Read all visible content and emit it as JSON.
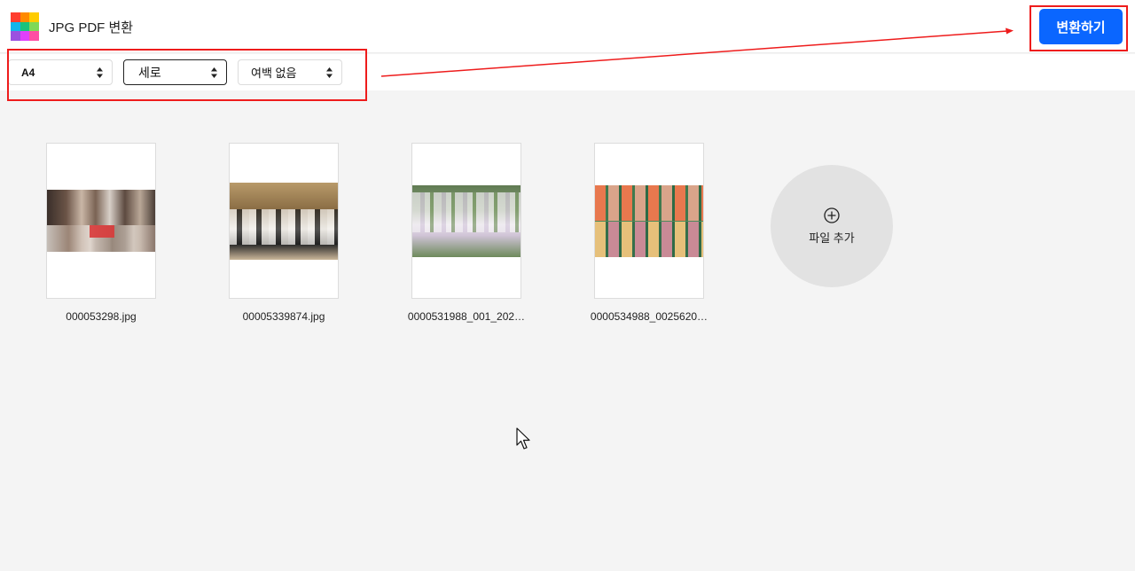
{
  "header": {
    "title": "JPG PDF 변환",
    "convert_label": "변환하기",
    "logo_colors": [
      "#ff3d2e",
      "#ff8a00",
      "#ffcc00",
      "#19c37d",
      "#13b5ea",
      "#2f80ed",
      "#9b51e0",
      "#e040fb",
      "#ff4fa3"
    ]
  },
  "toolbar": {
    "page_size": "A4",
    "orientation": "세로",
    "margin": "여백 없음"
  },
  "files": [
    {
      "name": "000053298.jpg",
      "icon": "photo-thumbnail"
    },
    {
      "name": "00005339874.jpg",
      "icon": "photo-thumbnail"
    },
    {
      "name": "0000531988_001_202…",
      "icon": "photo-thumbnail"
    },
    {
      "name": "0000534988_0025620…",
      "icon": "photo-thumbnail"
    }
  ],
  "add_file": {
    "label": "파일 추가",
    "icon": "circle-plus-icon"
  },
  "colors": {
    "accent": "#0a66ff",
    "annotation": "#ee1c1c",
    "background": "#f4f4f4"
  }
}
